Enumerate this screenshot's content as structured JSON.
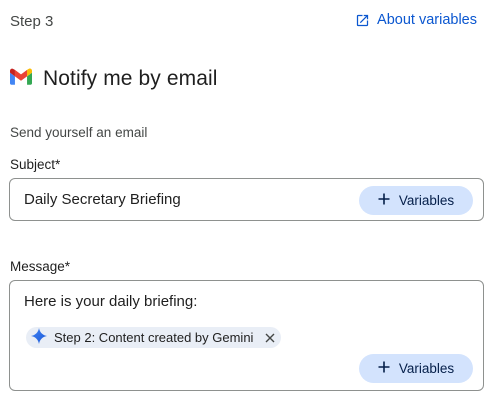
{
  "step_label": "Step 3",
  "about_link": {
    "label": "About variables",
    "icon": "open-in-new-icon",
    "color": "#0b57d0"
  },
  "action": {
    "title": "Notify me by email",
    "icon": "gmail-icon"
  },
  "description": "Send yourself an email",
  "subject": {
    "label": "Subject*",
    "value": "Daily Secretary Briefing",
    "variables_button": "Variables"
  },
  "message": {
    "label": "Message*",
    "text": "Here is your daily briefing:",
    "chip": {
      "label": "Step 2: Content created by Gemini",
      "icon": "gemini-sparkle-icon"
    },
    "variables_button": "Variables"
  },
  "colors": {
    "accent": "#0b57d0",
    "button_bg": "#d3e3fd",
    "chip_bg": "#e9eef6",
    "border": "#8e918f"
  }
}
